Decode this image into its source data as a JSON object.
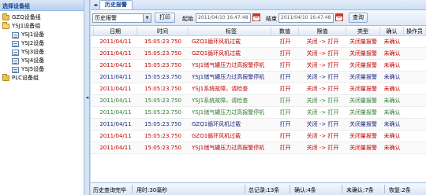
{
  "sidebar": {
    "title": "选择设备组",
    "tree": [
      {
        "label": "GZQ设备组",
        "level": 0,
        "icon": "folder-icon"
      },
      {
        "label": "YSJ1设备组",
        "level": 0,
        "icon": "folder-open-icon"
      },
      {
        "label": "YSJ1设备",
        "level": 1,
        "icon": "device-icon"
      },
      {
        "label": "YSJ2设备",
        "level": 1,
        "icon": "device-icon"
      },
      {
        "label": "YSJ3设备",
        "level": 1,
        "icon": "device-icon"
      },
      {
        "label": "YSJ4设备",
        "level": 1,
        "icon": "device-icon"
      },
      {
        "label": "YSJ5设备",
        "level": 1,
        "icon": "device-icon"
      },
      {
        "label": "PLC设备组",
        "level": 0,
        "icon": "folder-icon"
      }
    ]
  },
  "tabs": [
    {
      "label": "历史报警",
      "active": true
    }
  ],
  "toolbar": {
    "select_value": "历史报警",
    "print_label": "打印",
    "start_label": "起始",
    "start_value": "2011/04/10 16:47:48",
    "end_label": "结束",
    "end_value": "2011/04/10 16:47:48",
    "query_label": "查询"
  },
  "grid": {
    "columns": [
      "日期",
      "时间",
      "标签",
      "数值",
      "限值",
      "类型",
      "确认",
      "操作员"
    ],
    "rows": [
      {
        "date": "2011/04/11",
        "time": "15:05:23.750",
        "tag": "GZQ1循环风机过载",
        "value": "打开",
        "limit": "关闭 -> 打开",
        "type": "关闭量报警",
        "ack": "未确认",
        "operator": "",
        "color": "#c00000"
      },
      {
        "date": "2011/04/11",
        "time": "15:05:23.750",
        "tag": "GZQ1循环风机过载",
        "value": "打开",
        "limit": "关闭 -> 打开",
        "type": "关闭量报警",
        "ack": "未确认",
        "operator": "",
        "color": "#c00000"
      },
      {
        "date": "2011/04/11",
        "time": "15:05:23.750",
        "tag": "YSJ1储气罐压力过高报警停机",
        "value": "打开",
        "limit": "关闭 -> 打开",
        "type": "关闭量报警",
        "ack": "未确认",
        "operator": "",
        "color": "#c00000"
      },
      {
        "date": "2011/04/11",
        "time": "15:05:23.750",
        "tag": "YSJ1储气罐压力过高报警停机",
        "value": "打开",
        "limit": "关闭 -> 打开",
        "type": "关闭量报警",
        "ack": "未确认",
        "operator": "",
        "color": "#1a237e"
      },
      {
        "date": "2011/04/11",
        "time": "15:05:23.750",
        "tag": "YSJ1系统故障，请检查",
        "value": "打开",
        "limit": "关闭 -> 打开",
        "type": "关闭量报警",
        "ack": "未确认",
        "operator": "",
        "color": "#c00000"
      },
      {
        "date": "2011/04/11",
        "time": "15:05:23.750",
        "tag": "YSJ1系统故障，请检查",
        "value": "打开",
        "limit": "关闭 -> 打开",
        "type": "关闭量报警",
        "ack": "未确认",
        "operator": "",
        "color": "#2e7d32"
      },
      {
        "date": "2011/04/11",
        "time": "15:05:23.750",
        "tag": "YSJ1储气罐压力过高报警停机",
        "value": "打开",
        "limit": "关闭 -> 打开",
        "type": "关闭量报警",
        "ack": "未确认",
        "operator": "",
        "color": "#2e7d32"
      },
      {
        "date": "2011/04/11",
        "time": "15:05:23.750",
        "tag": "GZQ1循环风机过载",
        "value": "打开",
        "limit": "关闭 -> 打开",
        "type": "关闭量报警",
        "ack": "未确认",
        "operator": "",
        "color": "#1a237e"
      },
      {
        "date": "2011/04/11",
        "time": "15:05:23.750",
        "tag": "GZQ1循环风机过载",
        "value": "打开",
        "limit": "关闭 -> 打开",
        "type": "关闭量报警",
        "ack": "未确认",
        "operator": "",
        "color": "#c00000"
      },
      {
        "date": "2011/04/11",
        "time": "15:05:23.750",
        "tag": "YSJ1储气罐压力过高报警停机",
        "value": "打开",
        "limit": "关闭 -> 打开",
        "type": "关闭量报警",
        "ack": "未确认",
        "operator": "",
        "color": "#c00000"
      }
    ]
  },
  "statusbar": {
    "status": "历史查询完毕",
    "elapsed": "用时:30毫秒",
    "total": "总记录:13条",
    "acked": "确认:4条",
    "unacked": "未确认:7条",
    "recovered": "恢复:2条"
  }
}
